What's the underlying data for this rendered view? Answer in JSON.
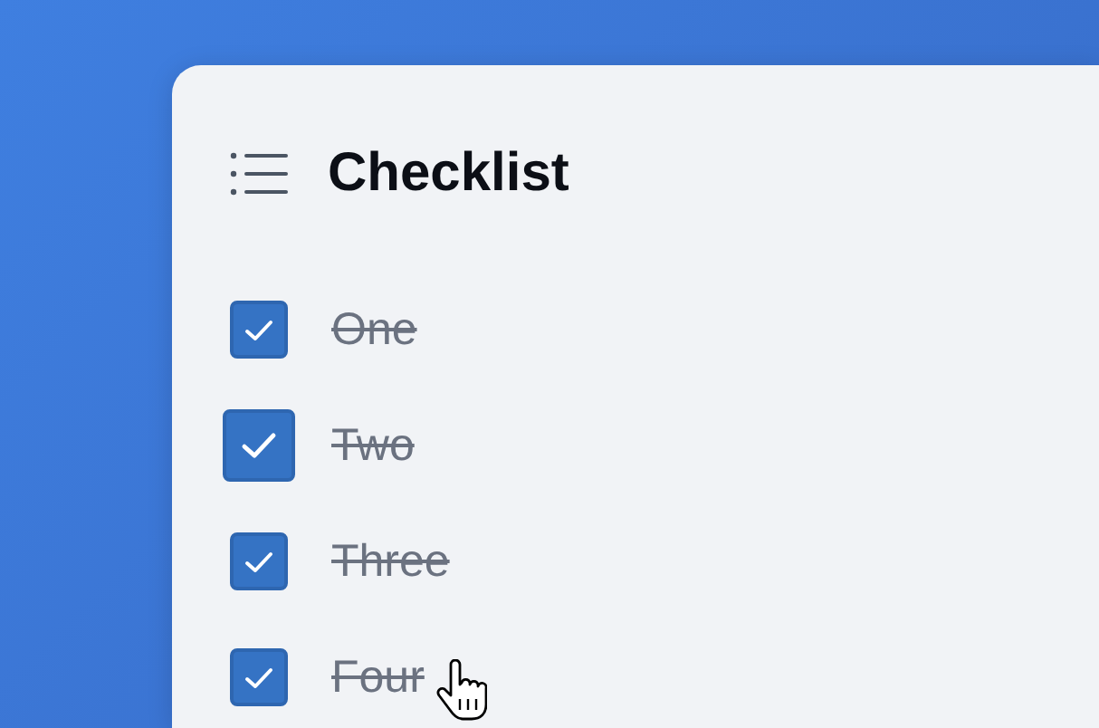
{
  "card": {
    "title": "Checklist"
  },
  "items": [
    {
      "label": "One",
      "checked": true,
      "focused": false
    },
    {
      "label": "Two",
      "checked": true,
      "focused": true
    },
    {
      "label": "Three",
      "checked": true,
      "focused": false
    },
    {
      "label": "Four",
      "checked": true,
      "focused": false
    }
  ]
}
